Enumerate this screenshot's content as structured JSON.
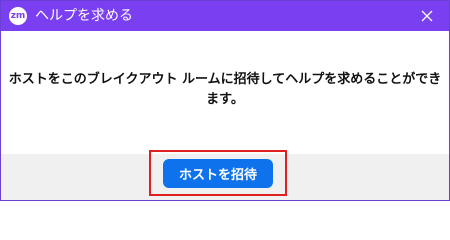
{
  "window": {
    "title": "ヘルプを求める",
    "app_icon_text": "zm",
    "close_icon": "close-icon"
  },
  "dialog": {
    "message": "ホストをこのブレイクアウト ルームに招待してヘルプを求めることができます。",
    "invite_button_label": "ホストを招待"
  },
  "colors": {
    "titlebar": "#7a3ff0",
    "primary_button": "#0e72ed",
    "highlight": "#e02020",
    "footer": "#f0f0f0"
  }
}
